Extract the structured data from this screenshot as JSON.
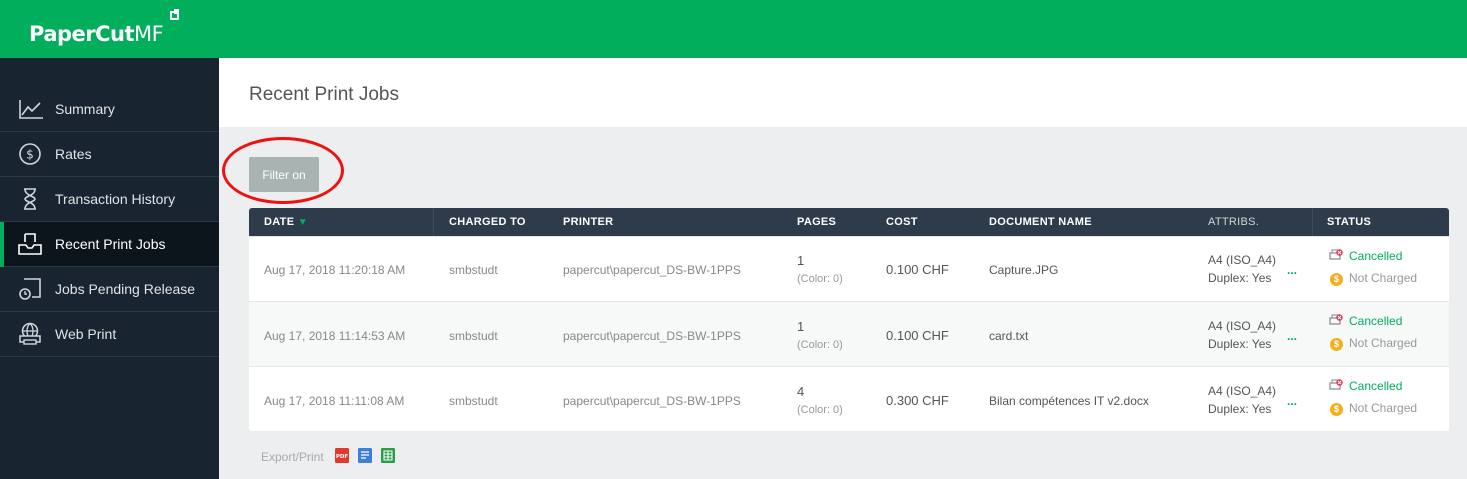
{
  "app": {
    "logo_main": "PaperCut",
    "logo_suffix": "MF"
  },
  "sidebar": {
    "items": [
      {
        "label": "Summary",
        "icon": "chart-line-icon"
      },
      {
        "label": "Rates",
        "icon": "dollar-circle-icon"
      },
      {
        "label": "Transaction History",
        "icon": "hourglass-icon"
      },
      {
        "label": "Recent Print Jobs",
        "icon": "print-tray-icon",
        "active": true
      },
      {
        "label": "Jobs Pending Release",
        "icon": "pending-document-icon"
      },
      {
        "label": "Web Print",
        "icon": "globe-printer-icon"
      }
    ]
  },
  "page": {
    "title": "Recent Print Jobs"
  },
  "filter": {
    "label": "Filter on"
  },
  "table": {
    "headers": {
      "date": "DATE",
      "charged_to": "CHARGED TO",
      "printer": "PRINTER",
      "pages": "PAGES",
      "cost": "COST",
      "document": "DOCUMENT NAME",
      "attribs": "ATTRIBS.",
      "status": "STATUS"
    },
    "sort_arrow": "▼",
    "rows": [
      {
        "date": "Aug 17, 2018 11:20:18 AM",
        "charged_to": "smbstudt",
        "printer": "papercut\\papercut_DS-BW-1PPS",
        "pages": "1",
        "color": "(Color: 0)",
        "cost": "0.100 CHF",
        "document": "Capture.JPG",
        "attr_size": "A4 (ISO_A4)",
        "attr_duplex": "Duplex: Yes",
        "more": "...",
        "status_main": "Cancelled",
        "status_charge": "Not Charged"
      },
      {
        "date": "Aug 17, 2018 11:14:53 AM",
        "charged_to": "smbstudt",
        "printer": "papercut\\papercut_DS-BW-1PPS",
        "pages": "1",
        "color": "(Color: 0)",
        "cost": "0.100 CHF",
        "document": "card.txt",
        "attr_size": "A4 (ISO_A4)",
        "attr_duplex": "Duplex: Yes",
        "more": "...",
        "status_main": "Cancelled",
        "status_charge": "Not Charged"
      },
      {
        "date": "Aug 17, 2018 11:11:08 AM",
        "charged_to": "smbstudt",
        "printer": "papercut\\papercut_DS-BW-1PPS",
        "pages": "4",
        "color": "(Color: 0)",
        "cost": "0.300 CHF",
        "document": "Bilan compétences IT v2.docx",
        "attr_size": "A4 (ISO_A4)",
        "attr_duplex": "Duplex: Yes",
        "more": "...",
        "status_main": "Cancelled",
        "status_charge": "Not Charged"
      }
    ]
  },
  "export": {
    "label": "Export/Print",
    "pdf_label": "PDF",
    "coin_symbol": "$"
  },
  "colors": {
    "brand": "#00ae5c",
    "sidebar": "#182430",
    "table_head": "#2e3b4b",
    "annotation": "#ee1111"
  }
}
